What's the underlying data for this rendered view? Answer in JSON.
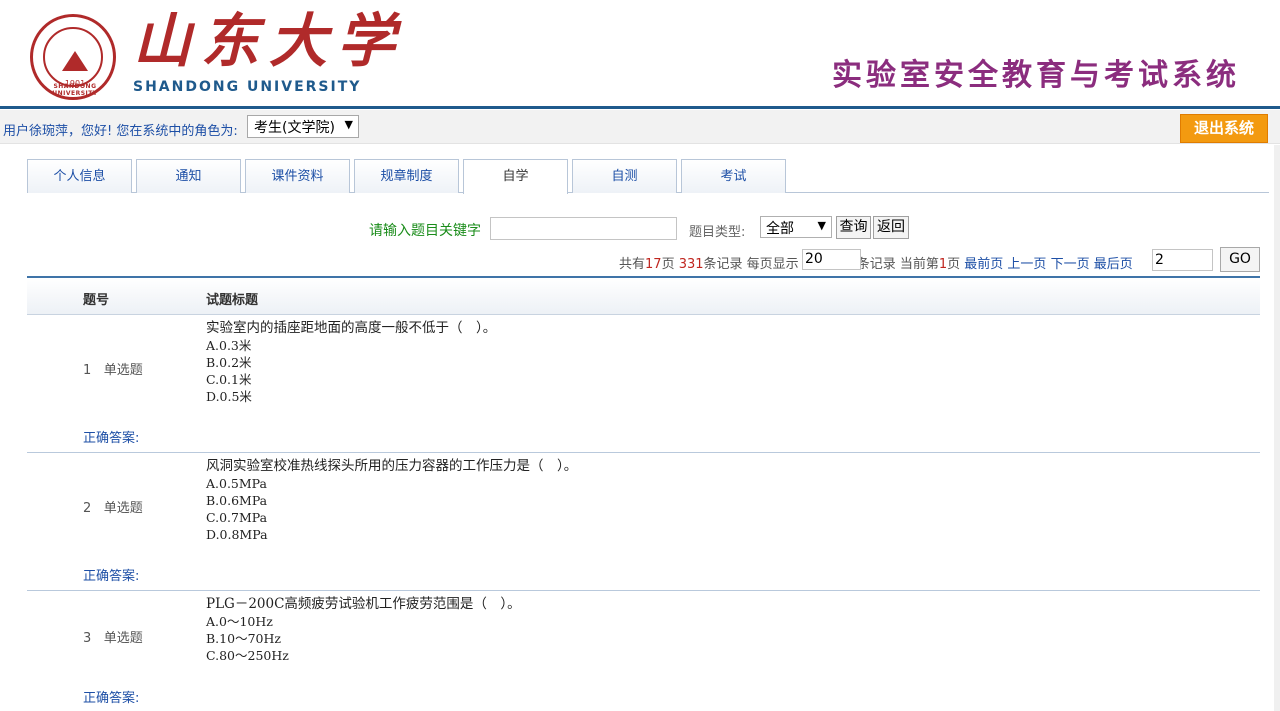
{
  "header": {
    "logo_seal_year": "1901",
    "logo_seal_ring": "SHANDONG UNIVERSITY",
    "logo_calligraphy": "山东大学",
    "logo_english": "SHANDONG UNIVERSITY",
    "system_title": "实验室安全教育与考试系统"
  },
  "userbar": {
    "greeting": "用户徐琬萍，您好! 您在系统中的角色为:",
    "role_value": "考生(文学院)",
    "logout_label": "退出系统"
  },
  "tabs": [
    {
      "label": "个人信息"
    },
    {
      "label": "通知"
    },
    {
      "label": "课件资料"
    },
    {
      "label": "规章制度"
    },
    {
      "label": "自学",
      "active": true
    },
    {
      "label": "自测"
    },
    {
      "label": "考试"
    }
  ],
  "search": {
    "keyword_label": "请输入题目关键字",
    "keyword_value": "",
    "type_label": "题目类型:",
    "type_value": "全部",
    "query_label": "查询",
    "back_label": "返回"
  },
  "pager": {
    "prefix": "共有",
    "total_pages": "17",
    "pages_suffix": "页",
    "total_records": "331",
    "records_text": "条记录 每页显示",
    "per_page": "20",
    "per_page_suffix": "条记录  当前第",
    "current_page": "1",
    "current_suffix": "页",
    "first_label": "最前页",
    "prev_label": "上一页",
    "next_label": "下一页",
    "last_label": "最后页",
    "goto_value": "2",
    "go_label": "GO"
  },
  "table": {
    "col_number": "题号",
    "col_title": "试题标题",
    "rows": [
      {
        "number": "1",
        "type": "单选题",
        "title": "实验室内的插座距地面的高度一般不低于（　）。",
        "options": [
          "A.0.3米",
          "B.0.2米",
          "C.0.1米",
          "D.0.5米"
        ],
        "answer_label": "正确答案:"
      },
      {
        "number": "2",
        "type": "单选题",
        "title": "风洞实验室校准热线探头所用的压力容器的工作压力是（　）。",
        "options": [
          "A.0.5MPa",
          "B.0.6MPa",
          "C.0.7MPa",
          "D.0.8MPa"
        ],
        "answer_label": "正确答案:"
      },
      {
        "number": "3",
        "type": "单选题",
        "title": "PLG－200C高频疲劳试验机工作疲劳范围是（　）。",
        "options": [
          "A.0～10Hz",
          "B.10～70Hz",
          "C.80～250Hz"
        ],
        "answer_label": "正确答案:"
      }
    ]
  }
}
